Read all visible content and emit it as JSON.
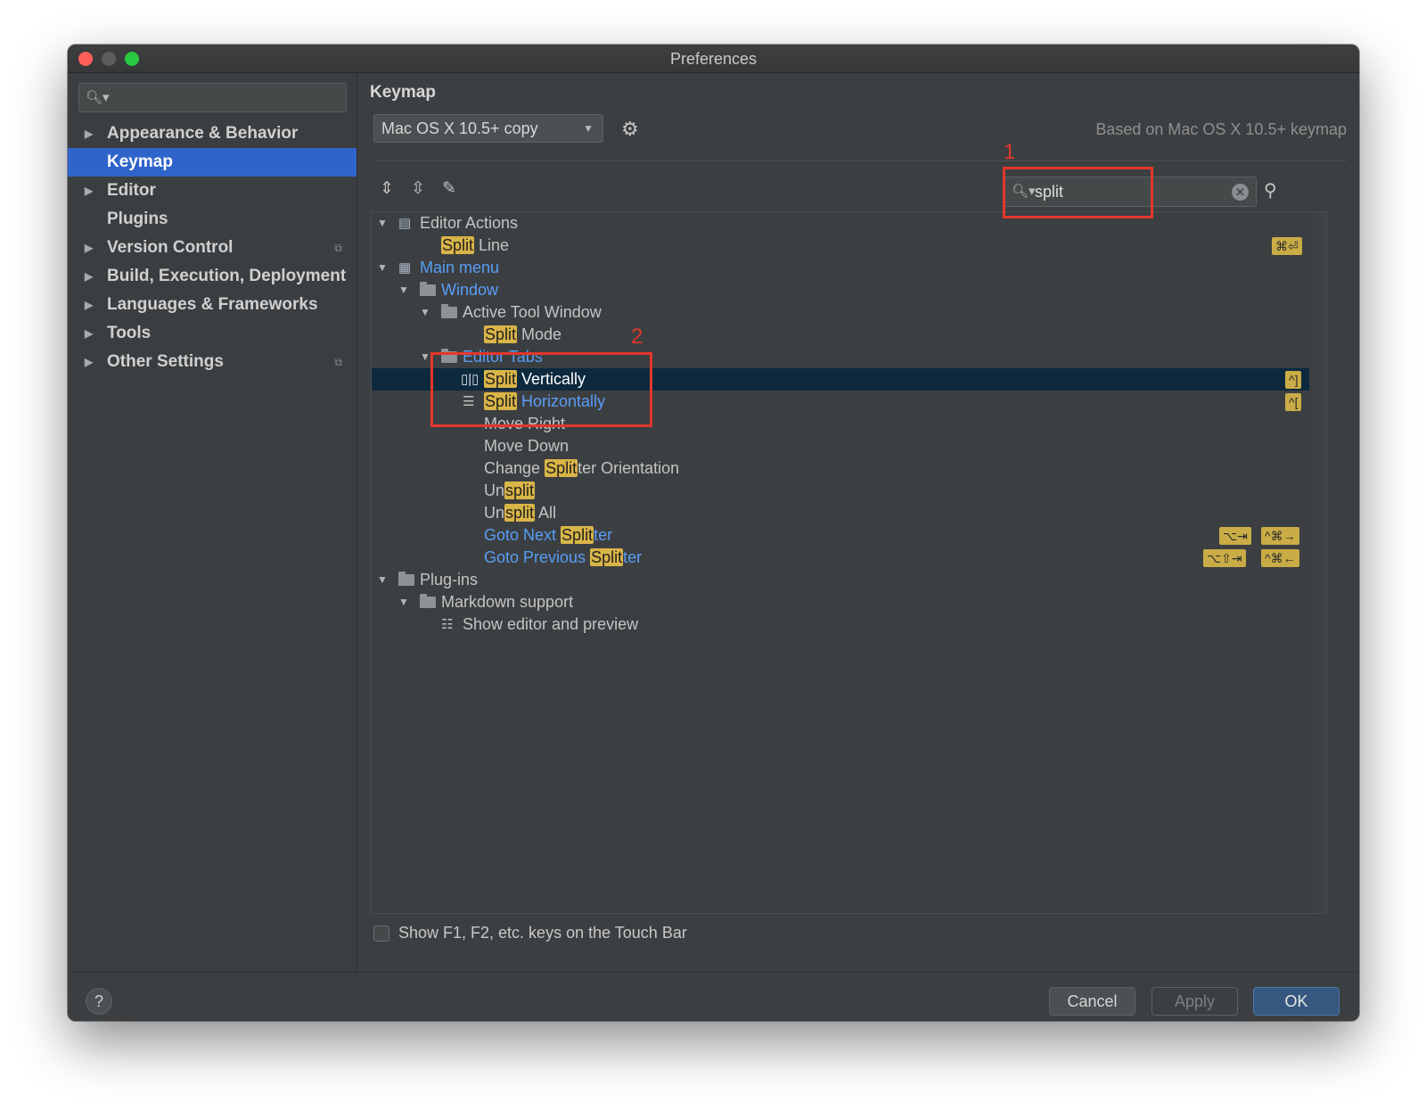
{
  "window": {
    "title": "Preferences"
  },
  "sidebar": {
    "search_placeholder": "",
    "items": [
      {
        "label": "Appearance & Behavior",
        "expandable": true
      },
      {
        "label": "Keymap",
        "selected": true
      },
      {
        "label": "Editor",
        "expandable": true
      },
      {
        "label": "Plugins"
      },
      {
        "label": "Version Control",
        "expandable": true,
        "project_icon": "copy-icon"
      },
      {
        "label": "Build, Execution, Deployment",
        "expandable": true
      },
      {
        "label": "Languages & Frameworks",
        "expandable": true
      },
      {
        "label": "Tools",
        "expandable": true
      },
      {
        "label": "Other Settings",
        "expandable": true,
        "project_icon": "copy-icon"
      }
    ]
  },
  "keymap": {
    "heading": "Keymap",
    "selected_keymap": "Mac OS X 10.5+ copy",
    "based_on": "Based on Mac OS X 10.5+ keymap",
    "search_value": "split",
    "touchbar_label": "Show F1, F2, etc. keys on the Touch Bar"
  },
  "tree": {
    "editor_actions": "Editor Actions",
    "split_line": {
      "hl": "Split",
      "rest": " Line",
      "shortcut": "⌘⏎"
    },
    "main_menu": "Main menu",
    "window": "Window",
    "active_tool_window": "Active Tool Window",
    "split_mode": {
      "hl": "Split",
      "rest": " Mode"
    },
    "editor_tabs": "Editor Tabs",
    "split_vertically": {
      "hl": "Split",
      "rest": " Vertically",
      "shortcut": "^]"
    },
    "split_horizontally": {
      "hl": "Split",
      "rest": " Horizontally",
      "shortcut": "^["
    },
    "move_right": "Move Right",
    "move_down": "Move Down",
    "change_splitter": {
      "pre": "Change ",
      "hl": "Split",
      "rest": "ter Orientation"
    },
    "unsplit": {
      "pre": "Un",
      "hl": "split"
    },
    "unsplit_all": {
      "pre": "Un",
      "hl": "split",
      "rest": " All"
    },
    "goto_next": {
      "pre": "Goto Next ",
      "hl": "Split",
      "rest": "ter",
      "shortcut1": "⌥⇥",
      "shortcut2": "^⌘→"
    },
    "goto_prev": {
      "pre": "Goto Previous ",
      "hl": "Split",
      "rest": "ter",
      "shortcut1": "⌥⇧⇥",
      "shortcut2": "^⌘←"
    },
    "plugins": "Plug-ins",
    "markdown_support": "Markdown support",
    "show_editor_preview": "Show editor and preview"
  },
  "buttons": {
    "cancel": "Cancel",
    "apply": "Apply",
    "ok": "OK",
    "help": "?"
  },
  "annotations": {
    "one": "1",
    "two": "2"
  },
  "colors": {
    "accent": "#2f65ca",
    "highlight": "#d9b548",
    "link": "#589df6",
    "annotation": "#e3372a"
  }
}
